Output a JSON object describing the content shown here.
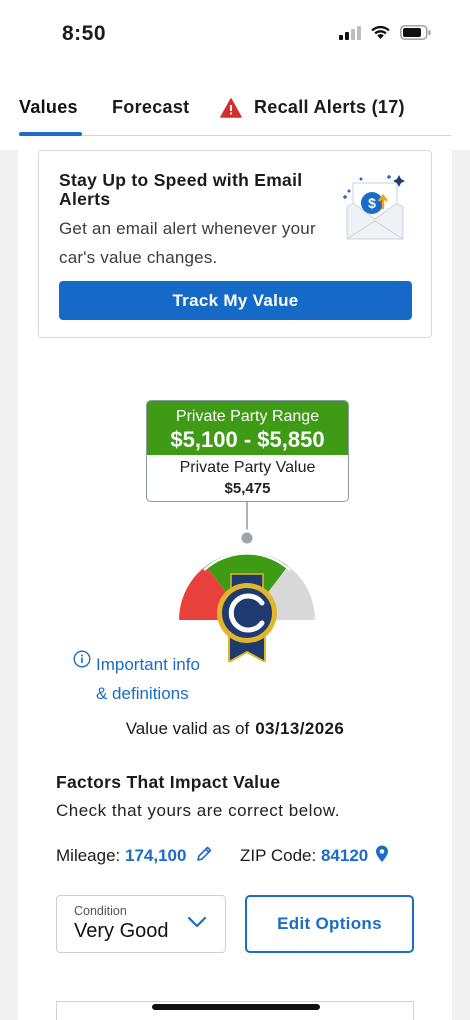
{
  "status": {
    "time": "8:50"
  },
  "tabs": [
    {
      "label": "Values",
      "active": true
    },
    {
      "label": "Forecast",
      "active": false
    },
    {
      "label": "Recall Alerts (17)",
      "active": false,
      "icon": "warning-icon"
    }
  ],
  "email_alert": {
    "title": "Stay Up to Speed with Email Alerts",
    "description": "Get an email alert whenever your car's value changes.",
    "button_label": "Track My Value"
  },
  "value_box": {
    "range_label": "Private Party Range",
    "range_value": "$5,100 - $5,850",
    "value_label": "Private Party Value",
    "value": "$5,475"
  },
  "info_link": {
    "line1": "Important info",
    "line2": "& definitions"
  },
  "valid": {
    "label": "Value valid as of",
    "date": "03/13/2026"
  },
  "factors": {
    "title": "Factors That Impact Value",
    "subtitle": "Check that yours are correct below.",
    "mileage_label": "Mileage:",
    "mileage_value": "174,100",
    "zip_label": "ZIP Code:",
    "zip_value": "84120"
  },
  "condition": {
    "label": "Condition",
    "value": "Very Good"
  },
  "edit_button": "Edit Options",
  "colors": {
    "accent": "#1a6cc6",
    "range_green": "#3f9a16",
    "gauge_red": "#e8413c",
    "gauge_gray": "#d9d9d9",
    "badge_navy": "#1f3a6e",
    "badge_gold": "#e3b52a"
  }
}
